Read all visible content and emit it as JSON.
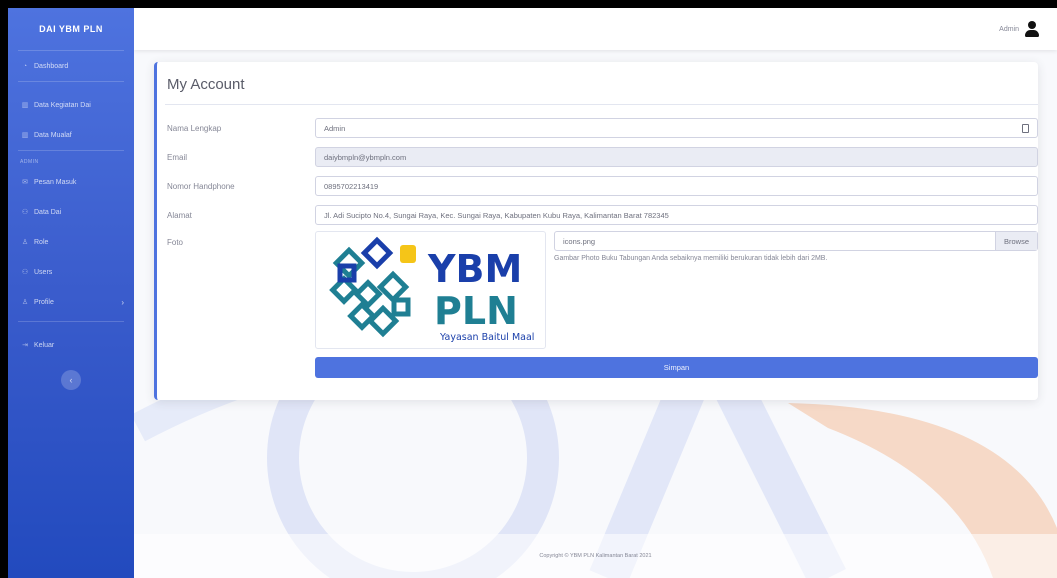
{
  "sidebar": {
    "brand": "DAI YBM PLN",
    "items": [
      {
        "label": "Dashboard",
        "icon": "tachometer-icon"
      },
      {
        "label": "Data Kegiatan Dai",
        "icon": "chart-icon"
      },
      {
        "label": "Data Mualaf",
        "icon": "chart-icon"
      }
    ],
    "heading": "ADMIN",
    "admin_items": [
      {
        "label": "Pesan Masuk",
        "icon": "envelope-icon"
      },
      {
        "label": "Data Dai",
        "icon": "users-icon"
      },
      {
        "label": "Role",
        "icon": "user-icon"
      },
      {
        "label": "Users",
        "icon": "users-icon"
      },
      {
        "label": "Profile",
        "icon": "user-icon"
      }
    ],
    "logout": "Keluar"
  },
  "topbar": {
    "user": "Admin"
  },
  "account": {
    "title": "My Account",
    "fields": {
      "name": {
        "label": "Nama Lengkap",
        "value": "Admin"
      },
      "email": {
        "label": "Email",
        "value": "daiybmpln@ybmpln.com"
      },
      "phone": {
        "label": "Nomor Handphone",
        "value": "0895702213419"
      },
      "address": {
        "label": "Alamat",
        "value": "Jl. Adi Sucipto No.4, Sungai Raya, Kec. Sungai Raya, Kabupaten Kubu Raya, Kalimantan Barat 782345"
      },
      "photo": {
        "label": "Foto",
        "file": "icons.png",
        "browse": "Browse",
        "help": "Gambar Photo Buku Tabungan Anda sebaiknya memiliki berukuran tidak lebih dari 2MB."
      }
    },
    "logo": {
      "line1": "YBM",
      "line2": "PLN",
      "tagline": "Yayasan Baitul Maal"
    },
    "save": "Simpan"
  },
  "footer": "Copyright © YBM PLN Kalimantan Barat 2021",
  "colors": {
    "primary": "#4e73df",
    "logo_blue": "#1a3faa",
    "logo_teal": "#1f7f93",
    "logo_yellow": "#f5c518",
    "watermark_orange": "#f08a3c"
  }
}
